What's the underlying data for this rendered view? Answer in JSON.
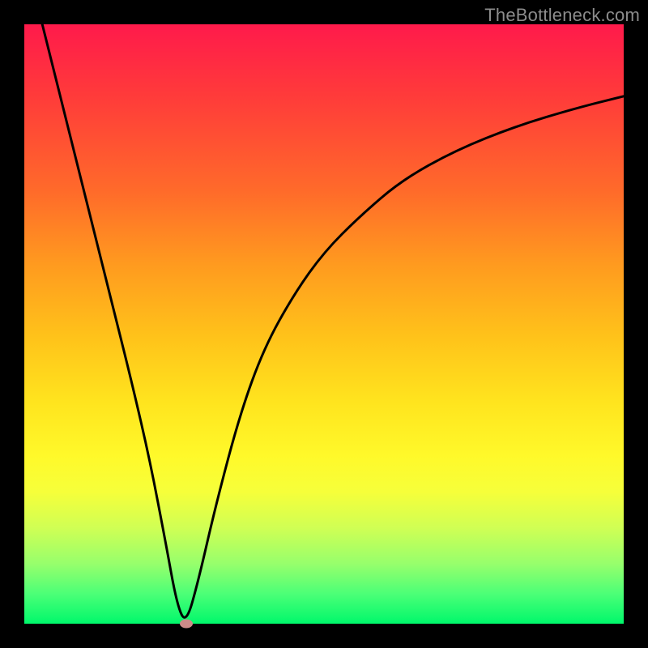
{
  "watermark": {
    "text": "TheBottleneck.com"
  },
  "chart_data": {
    "type": "line",
    "title": "",
    "xlabel": "",
    "ylabel": "",
    "xlim": [
      0,
      100
    ],
    "ylim": [
      0,
      100
    ],
    "background": "vertical-gradient",
    "gradient_stops": [
      {
        "pos": 0,
        "color": "#ff1a4b"
      },
      {
        "pos": 12,
        "color": "#ff3b3a"
      },
      {
        "pos": 28,
        "color": "#ff6b2a"
      },
      {
        "pos": 40,
        "color": "#ff9a1f"
      },
      {
        "pos": 52,
        "color": "#ffc21a"
      },
      {
        "pos": 63,
        "color": "#ffe41e"
      },
      {
        "pos": 72,
        "color": "#fff92a"
      },
      {
        "pos": 78,
        "color": "#f6ff3a"
      },
      {
        "pos": 84,
        "color": "#d0ff54"
      },
      {
        "pos": 90,
        "color": "#97ff6c"
      },
      {
        "pos": 95,
        "color": "#4cff77"
      },
      {
        "pos": 100,
        "color": "#00f86b"
      }
    ],
    "series": [
      {
        "name": "bottleneck-curve",
        "color": "#000000",
        "x": [
          3,
          6,
          9,
          12,
          15,
          18,
          21,
          23.5,
          25.5,
          27,
          29,
          32,
          36,
          40,
          45,
          50,
          56,
          63,
          72,
          82,
          92,
          100
        ],
        "y": [
          100,
          88,
          76,
          64,
          52,
          40,
          27,
          14,
          3,
          0,
          7,
          20,
          35,
          46,
          55,
          62,
          68,
          74,
          79,
          83,
          86,
          88
        ]
      }
    ],
    "annotations": [
      {
        "type": "marker",
        "name": "minimum-dot",
        "x": 27,
        "y": 0,
        "color": "#cd8b89"
      }
    ],
    "grid": false,
    "legend": false
  }
}
